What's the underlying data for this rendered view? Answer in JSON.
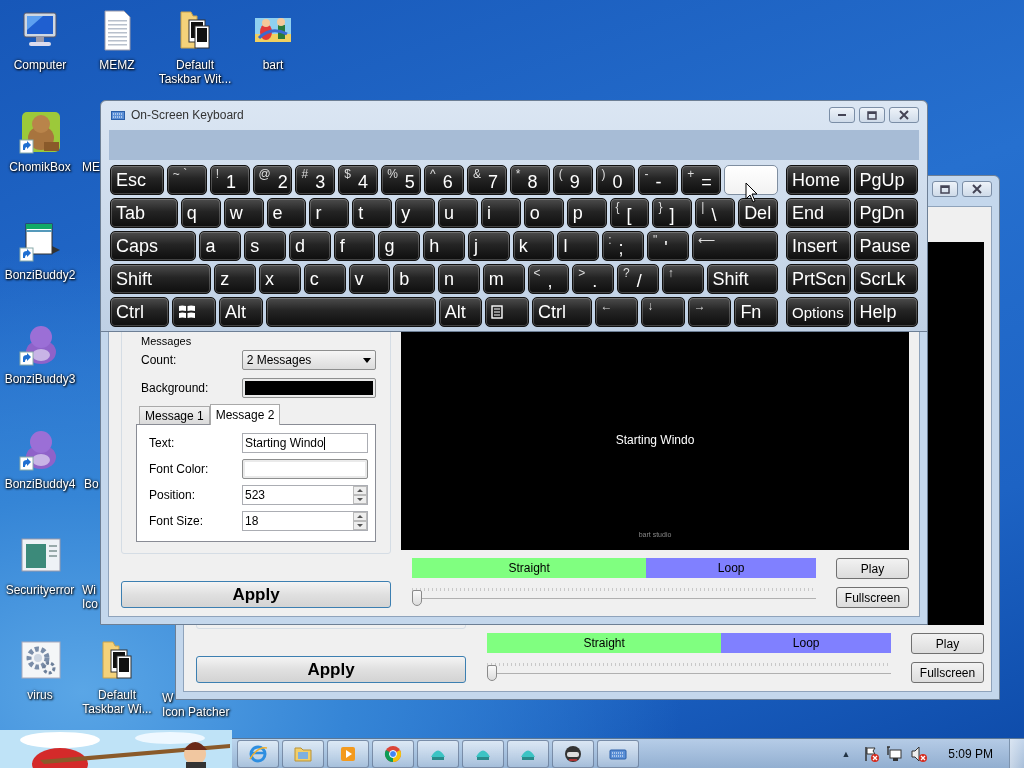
{
  "desktop_icons": [
    {
      "kind": "computer",
      "lines": [
        "Computer"
      ],
      "shortcut": false
    },
    {
      "kind": "document",
      "lines": [
        "MEMZ"
      ],
      "shortcut": false
    },
    {
      "kind": "folder",
      "lines": [
        "Default",
        "Taskbar Wit..."
      ],
      "shortcut": false
    },
    {
      "kind": "picture",
      "lines": [
        "bart"
      ]
    },
    {
      "kind": "animal",
      "lines": [
        "ChomikBox"
      ],
      "shortcut": true
    },
    {
      "kind": "covered",
      "lines": [
        "ME"
      ]
    },
    {
      "kind": "window",
      "lines": [
        "BonziBuddy2"
      ],
      "shortcut": true
    },
    {
      "kind": "blob",
      "lines": [
        "BonziBuddy3"
      ],
      "shortcut": true
    },
    {
      "kind": "blob",
      "lines": [
        "BonziBuddy4"
      ],
      "shortcut": true
    },
    {
      "kind": "covered",
      "lines": [
        "Bo"
      ]
    },
    {
      "kind": "panel",
      "lines": [
        "Securityerror"
      ],
      "shortcut": false
    },
    {
      "kind": "covered",
      "lines": [
        "Wi",
        "Ico"
      ]
    },
    {
      "kind": "gear",
      "lines": [
        "virus"
      ],
      "shortcut": false
    },
    {
      "kind": "folder",
      "lines": [
        "Default",
        "Taskbar Wi..."
      ],
      "shortcut": false
    },
    {
      "kind": "covered",
      "lines": [
        "W",
        "Icon Patcher"
      ]
    }
  ],
  "background_window": {
    "caption_buttons": [
      {
        "kind": "maximize"
      },
      {
        "kind": "close"
      }
    ],
    "mode_bar": {
      "segments": [
        {
          "label": "Straight",
          "color": "#80ff80"
        },
        {
          "label": "Loop",
          "color": "#8080ff"
        }
      ]
    },
    "slider": {
      "level": 0
    },
    "buttons": [
      {
        "label": "Play"
      },
      {
        "label": "Fullscreen"
      }
    ],
    "apply": "Apply"
  },
  "app_window": {
    "messages": {
      "title": "Messages",
      "count_label": "Count:",
      "count_value": "2 Messages",
      "background": {
        "label": "Background:",
        "color": "#000000"
      },
      "tabs": [
        {
          "label": "Message 1",
          "selected": false
        },
        {
          "label": "Message 2",
          "selected": true
        }
      ],
      "fields": [
        {
          "kind": "text",
          "label": "Text:",
          "value": "Starting Windo"
        },
        {
          "kind": "color",
          "label": "Font Color:",
          "color": "#ffffff"
        },
        {
          "kind": "spinner",
          "label": "Position:",
          "value": "523"
        },
        {
          "kind": "spinner",
          "label": "Font Size:",
          "value": "18"
        }
      ]
    },
    "preview": {
      "text": "Starting Windo",
      "credit": "bart studio"
    },
    "mode_bar": {
      "segments": [
        {
          "label": "Straight",
          "color": "#80ff80"
        },
        {
          "label": "Loop",
          "color": "#8080ff"
        }
      ]
    },
    "slider": {
      "level": 0
    },
    "buttons": [
      {
        "label": "Play"
      },
      {
        "label": "Fullscreen"
      }
    ],
    "apply": "Apply"
  },
  "keyboard": {
    "title": "On-Screen Keyboard",
    "caption_buttons": [
      {
        "kind": "minimize"
      },
      {
        "kind": "maximize"
      },
      {
        "kind": "close"
      }
    ],
    "rows": [
      {
        "keys": [
          {
            "kind": "text",
            "main": "Esc",
            "hovered": false
          },
          {
            "kind": "text",
            "top": "~ `",
            "hovered": false
          },
          {
            "kind": "text",
            "top": "!",
            "main": "1",
            "hovered": false
          },
          {
            "kind": "text",
            "top": "@",
            "main": "2",
            "hovered": false
          },
          {
            "kind": "text",
            "top": "#",
            "main": "3",
            "hovered": false
          },
          {
            "kind": "text",
            "top": "$",
            "main": "4",
            "hovered": false
          },
          {
            "kind": "text",
            "top": "%",
            "main": "5",
            "hovered": false
          },
          {
            "kind": "text",
            "top": "^",
            "main": "6",
            "hovered": false
          },
          {
            "kind": "text",
            "top": "&",
            "main": "7",
            "hovered": false
          },
          {
            "kind": "text",
            "top": "*",
            "main": "8",
            "hovered": false
          },
          {
            "kind": "text",
            "top": "(",
            "main": "9",
            "hovered": false
          },
          {
            "kind": "text",
            "top": ")",
            "main": "0",
            "hovered": false
          },
          {
            "kind": "text",
            "top": "-",
            "main": "-",
            "hovered": false
          },
          {
            "kind": "text",
            "top": "+",
            "main": "=",
            "hovered": false
          },
          {
            "kind": "blank",
            "hovered": true
          }
        ],
        "nav": [
          {
            "kind": "text",
            "main": "Home",
            "hovered": false
          },
          {
            "kind": "text",
            "main": "PgUp",
            "hovered": false
          }
        ]
      },
      {
        "keys": [
          {
            "kind": "text",
            "main": "Tab",
            "hovered": false
          },
          {
            "kind": "text",
            "main": "q",
            "hovered": false
          },
          {
            "kind": "text",
            "main": "w",
            "hovered": false
          },
          {
            "kind": "text",
            "main": "e",
            "hovered": false
          },
          {
            "kind": "text",
            "main": "r",
            "hovered": false
          },
          {
            "kind": "text",
            "main": "t",
            "hovered": false
          },
          {
            "kind": "text",
            "main": "y",
            "hovered": false
          },
          {
            "kind": "text",
            "main": "u",
            "hovered": false
          },
          {
            "kind": "text",
            "main": "i",
            "hovered": false
          },
          {
            "kind": "text",
            "main": "o",
            "hovered": false
          },
          {
            "kind": "text",
            "main": "p",
            "hovered": false
          },
          {
            "kind": "text",
            "top": "{",
            "main": "[",
            "hovered": false
          },
          {
            "kind": "text",
            "top": "}",
            "main": "]",
            "hovered": false
          },
          {
            "kind": "text",
            "top": "|",
            "main": "\\",
            "hovered": false
          },
          {
            "kind": "text",
            "main": "Del",
            "hovered": false
          }
        ],
        "nav": [
          {
            "kind": "text",
            "main": "End",
            "hovered": false
          },
          {
            "kind": "text",
            "main": "PgDn",
            "hovered": false
          }
        ]
      },
      {
        "keys": [
          {
            "kind": "text",
            "main": "Caps",
            "hovered": false
          },
          {
            "kind": "text",
            "main": "a",
            "hovered": false
          },
          {
            "kind": "text",
            "main": "s",
            "hovered": false
          },
          {
            "kind": "text",
            "main": "d",
            "hovered": false
          },
          {
            "kind": "text",
            "main": "f",
            "hovered": false
          },
          {
            "kind": "text",
            "main": "g",
            "hovered": false
          },
          {
            "kind": "text",
            "main": "h",
            "hovered": false
          },
          {
            "kind": "text",
            "main": "j",
            "hovered": false
          },
          {
            "kind": "text",
            "main": "k",
            "hovered": false
          },
          {
            "kind": "text",
            "main": "l",
            "hovered": false
          },
          {
            "kind": "text",
            "top": ":",
            "main": ";",
            "hovered": false
          },
          {
            "kind": "text",
            "top": "\"",
            "main": "'",
            "hovered": false
          },
          {
            "kind": "text",
            "top": "⟵",
            "hovered": false
          }
        ],
        "nav": [
          {
            "kind": "text",
            "main": "Insert",
            "hovered": false
          },
          {
            "kind": "text",
            "main": "Pause",
            "hovered": false
          }
        ]
      },
      {
        "keys": [
          {
            "kind": "text",
            "main": "Shift",
            "hovered": false
          },
          {
            "kind": "text",
            "main": "z",
            "hovered": false
          },
          {
            "kind": "text",
            "main": "x",
            "hovered": false
          },
          {
            "kind": "text",
            "main": "c",
            "hovered": false
          },
          {
            "kind": "text",
            "main": "v",
            "hovered": false
          },
          {
            "kind": "text",
            "main": "b",
            "hovered": false
          },
          {
            "kind": "text",
            "main": "n",
            "hovered": false
          },
          {
            "kind": "text",
            "main": "m",
            "hovered": false
          },
          {
            "kind": "text",
            "top": "<",
            "main": ",",
            "hovered": false
          },
          {
            "kind": "text",
            "top": ">",
            "main": ".",
            "hovered": false
          },
          {
            "kind": "text",
            "top": "?",
            "main": "/",
            "hovered": false
          },
          {
            "kind": "text",
            "top": "↑",
            "hovered": false
          },
          {
            "kind": "text",
            "main": "Shift",
            "hovered": false
          }
        ],
        "nav": [
          {
            "kind": "text",
            "main": "PrtScn",
            "hovered": false
          },
          {
            "kind": "text",
            "main": "ScrLk",
            "hovered": false
          }
        ]
      },
      {
        "keys": [
          {
            "kind": "text",
            "main": "Ctrl",
            "hovered": false
          },
          {
            "kind": "logo",
            "hovered": false
          },
          {
            "kind": "text",
            "main": "Alt",
            "hovered": false
          },
          {
            "kind": "blank",
            "hovered": false
          },
          {
            "kind": "text",
            "main": "Alt",
            "hovered": false
          },
          {
            "kind": "menu",
            "hovered": false
          },
          {
            "kind": "text",
            "main": "Ctrl",
            "hovered": false
          },
          {
            "kind": "text",
            "top": "←",
            "hovered": false
          },
          {
            "kind": "text",
            "top": "↓",
            "hovered": false
          },
          {
            "kind": "text",
            "top": "→",
            "hovered": false
          },
          {
            "kind": "text",
            "main": "Fn",
            "hovered": false
          }
        ],
        "nav": [
          {
            "kind": "small",
            "main": "Options",
            "hovered": false
          },
          {
            "kind": "text",
            "main": "Help",
            "hovered": false
          }
        ]
      }
    ]
  },
  "taskbar": {
    "overflow": "▲",
    "clock": "5:09 PM"
  }
}
